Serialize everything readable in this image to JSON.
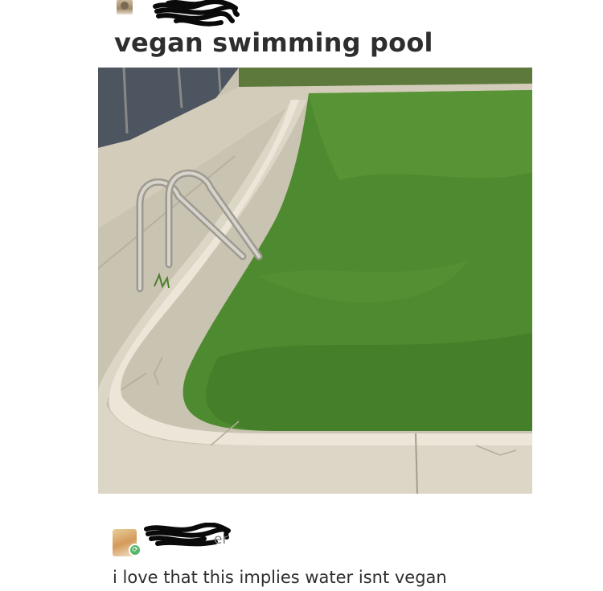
{
  "post": {
    "title": "vegan swimming pool",
    "author_name_redacted": true
  },
  "reply": {
    "name_visible_fragment": "er",
    "text": "i love that this implies water isnt vegan",
    "badge_glyph": "⟳"
  },
  "photo": {
    "description_icon": "pool-ladder-on-grass-lawn",
    "grass_color": "#4e8a2f",
    "sidewalk_color": "#cfc9b8",
    "curb_color": "#e2ddcf",
    "ladder_color": "#b9b6ae"
  }
}
